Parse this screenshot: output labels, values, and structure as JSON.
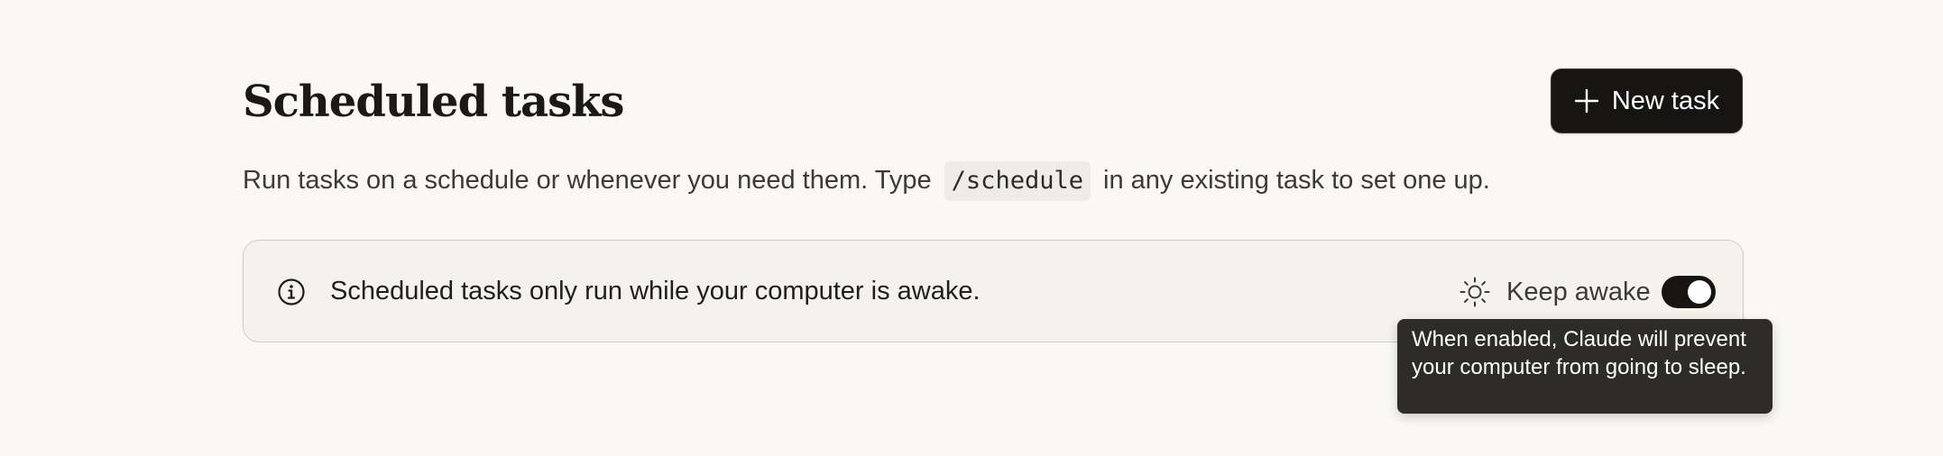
{
  "header": {
    "title": "Scheduled tasks",
    "new_task_label": "New task",
    "new_task_icon": "plus-icon"
  },
  "description": {
    "before_code": "Run tasks on a schedule or whenever you need them. Type",
    "code": "/schedule",
    "after_code": "in any existing task to set one up."
  },
  "banner": {
    "info_icon": "info-icon",
    "message": "Scheduled tasks only run while your computer is awake.",
    "keep_awake_icon": "sun-icon",
    "keep_awake_label": "Keep awake",
    "keep_awake_enabled": true
  },
  "tooltip": {
    "text": "When enabled, Claude will prevent your computer from going to sleep."
  },
  "colors": {
    "background": "#f9f8f4",
    "banner_background": "#f3f2eb",
    "button_background": "#161513",
    "tooltip_background": "#2d2c29"
  }
}
